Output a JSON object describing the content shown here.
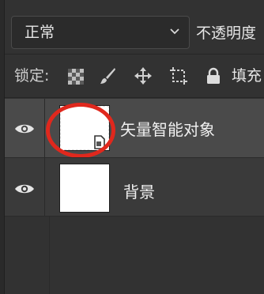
{
  "blend": {
    "mode": "正常",
    "opacity_label": "不透明度"
  },
  "lock": {
    "label": "锁定:",
    "fill_label": "填充",
    "icons": [
      "lock-transparent-pixels-icon",
      "lock-image-pixels-icon",
      "lock-position-icon",
      "lock-artboard-icon",
      "lock-all-icon"
    ]
  },
  "layers": [
    {
      "name": "矢量智能对象",
      "visible": true,
      "selected": true,
      "type": "smart-object"
    },
    {
      "name": "背景",
      "visible": true,
      "selected": false,
      "type": "background"
    }
  ],
  "colors": {
    "panel_bg": "#323232",
    "selected_row": "#4a4a4a",
    "row": "#3a3a3a",
    "annotation": "#e0281d"
  }
}
